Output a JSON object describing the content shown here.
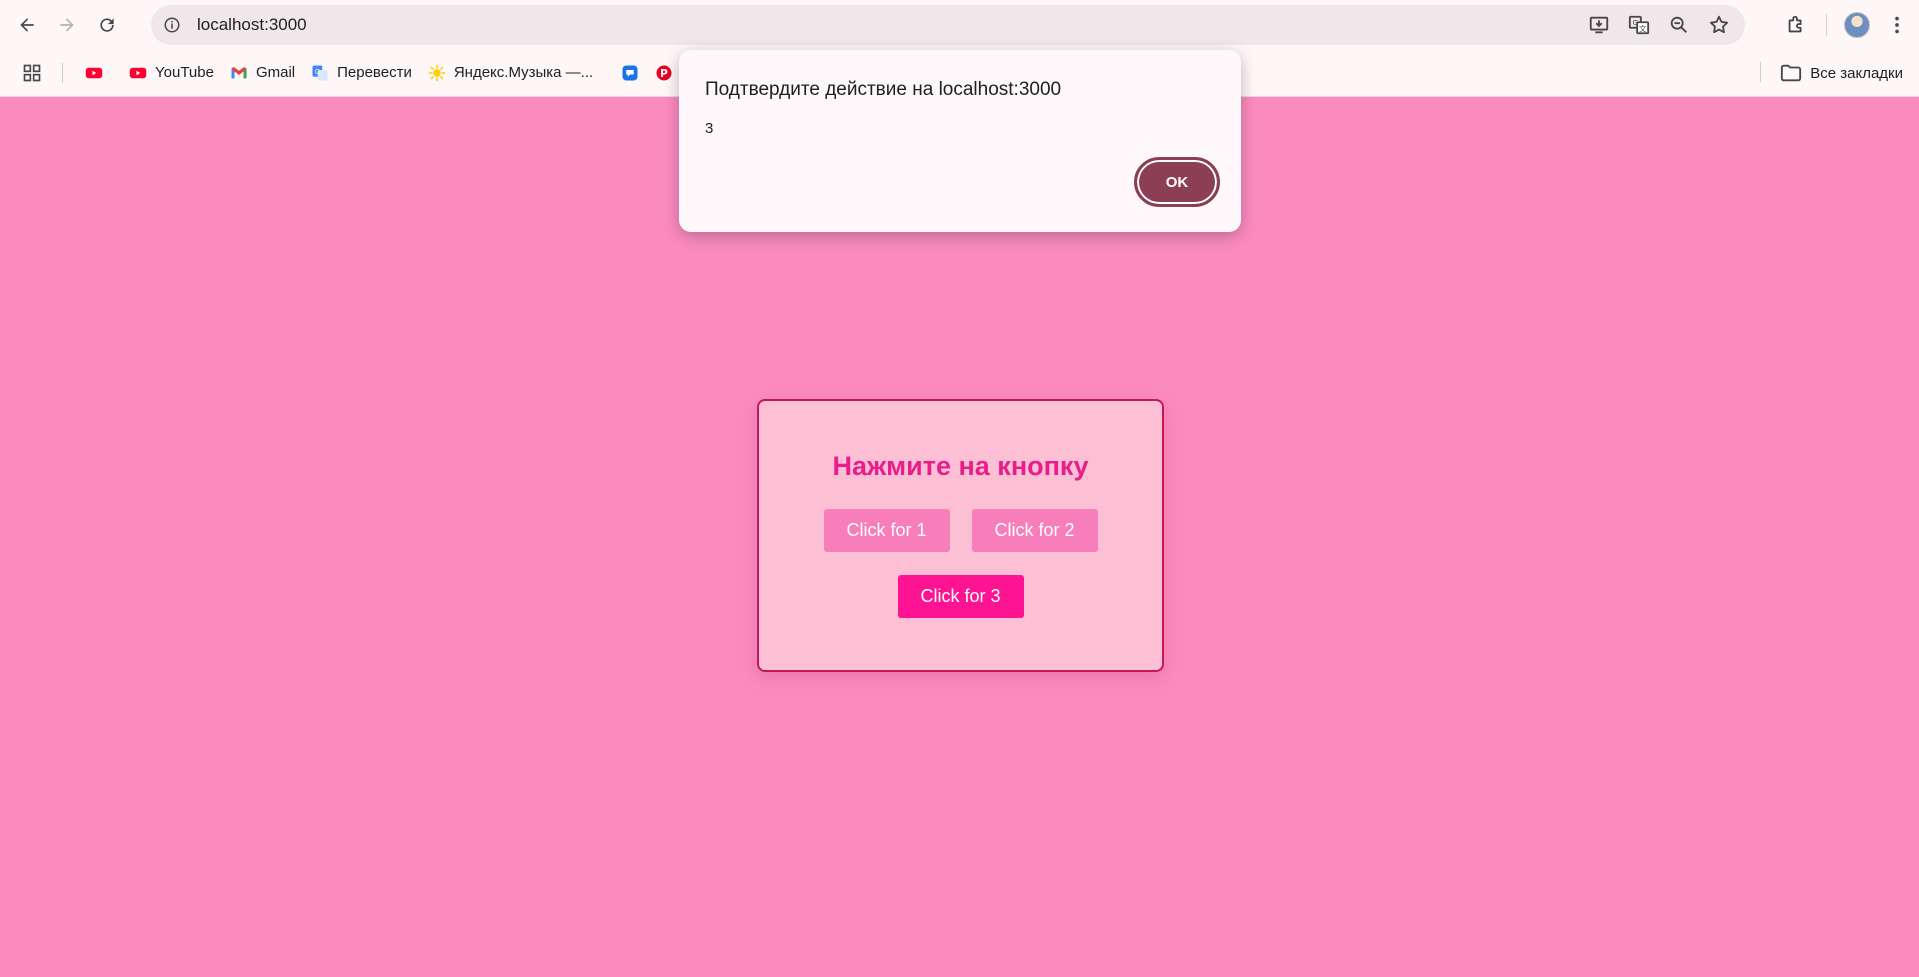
{
  "browser": {
    "url": "localhost:3000",
    "bookmarks": [
      {
        "label": "",
        "icon": "youtube-icon"
      },
      {
        "label": "YouTube",
        "icon": "youtube-icon"
      },
      {
        "label": "Gmail",
        "icon": "gmail-icon"
      },
      {
        "label": "Перевести",
        "icon": "translate-icon"
      },
      {
        "label": "Яндекс.Музыка —...",
        "icon": "yandex-music-icon"
      },
      {
        "label": "",
        "icon": "chat-icon"
      },
      {
        "label": "",
        "icon": "pinterest-icon"
      }
    ],
    "all_bookmarks_label": "Все закладки"
  },
  "dialog": {
    "title": "Подтвердите действие на localhost:3000",
    "message": "3",
    "ok_label": "OK"
  },
  "page": {
    "heading": "Нажмите на кнопку",
    "buttons": [
      {
        "label": "Click for 1"
      },
      {
        "label": "Click for 2"
      },
      {
        "label": "Click for 3"
      }
    ]
  },
  "colors": {
    "page_background": "#fb8bbf",
    "card_background": "#fdbfd3",
    "card_border": "#c2185b",
    "heading": "#e91e8c",
    "button": "#f87dbb",
    "button_active": "#fe1493",
    "dialog_ok": "#8c3e55"
  }
}
